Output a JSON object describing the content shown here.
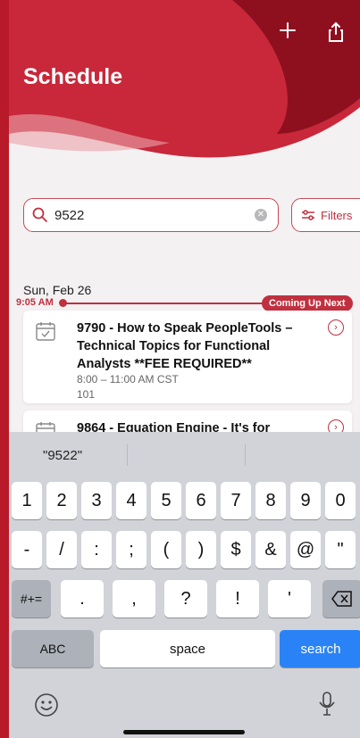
{
  "header": {
    "title": "Schedule",
    "add_icon": "plus-icon",
    "share_icon": "share-icon",
    "accent_color": "#c0303f"
  },
  "search": {
    "value": "9522",
    "clear_icon": "clear-icon",
    "filters_label": "Filters"
  },
  "timeline": {
    "date": "Sun, Feb 26",
    "now_time": "9:05 AM",
    "coming_up_label": "Coming Up Next"
  },
  "sessions": [
    {
      "title": "9790 - How to Speak PeopleTools – Technical Topics for Functional Analysts **FEE REQUIRED**",
      "time": "8:00 – 11:00 AM CST",
      "room": "101"
    },
    {
      "title": "9864 - Equation Engine - It's for",
      "time": "",
      "room": ""
    }
  ],
  "keyboard": {
    "suggestion": "\"9522\"",
    "row1": [
      "1",
      "2",
      "3",
      "4",
      "5",
      "6",
      "7",
      "8",
      "9",
      "0"
    ],
    "row2": [
      "-",
      "/",
      ":",
      ";",
      "(",
      ")",
      "$",
      "&",
      "@",
      "\""
    ],
    "row3_left": "#+=",
    "row3": [
      ".",
      ",",
      "?",
      "!",
      "'"
    ],
    "abc": "ABC",
    "space": "space",
    "search": "search"
  }
}
